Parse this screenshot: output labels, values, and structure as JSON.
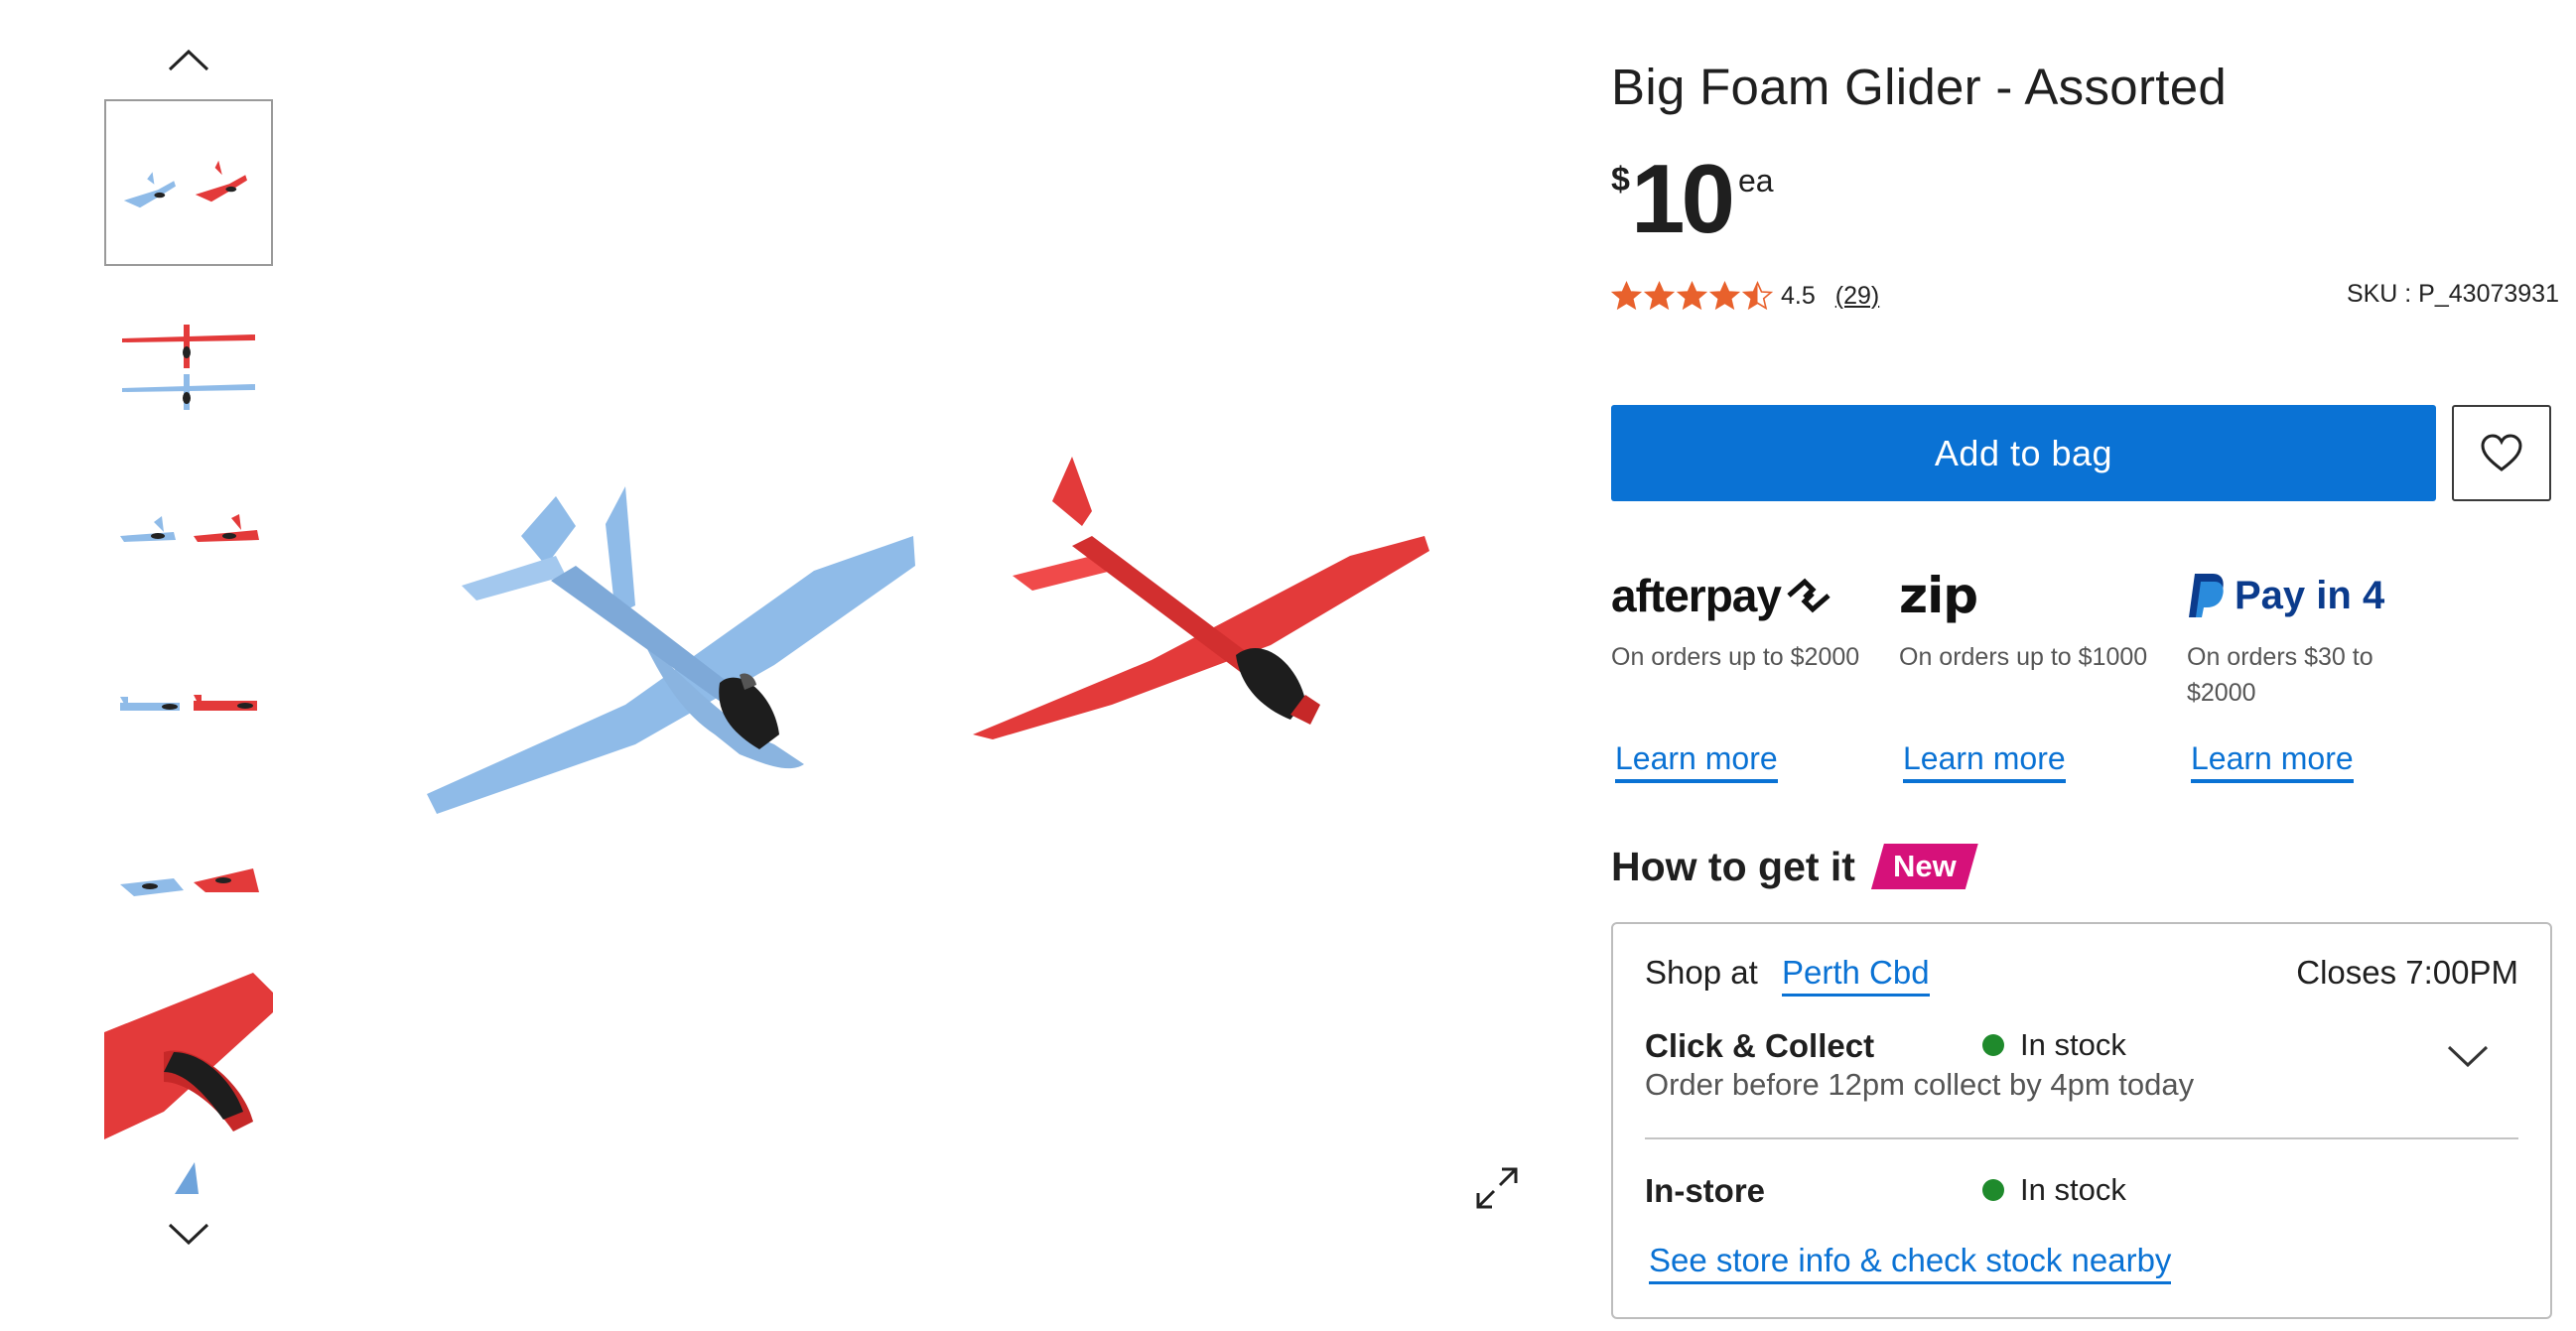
{
  "gallery": {
    "up_icon": "chevron-up-icon",
    "down_icon": "chevron-down-icon",
    "expand_icon": "expand-icon",
    "thumbnail_count": 7,
    "selected_index": 0
  },
  "product": {
    "title": "Big Foam Glider - Assorted",
    "price_currency": "$",
    "price_amount": "10",
    "price_unit": "ea",
    "rating_value": "4.5",
    "rating_stars": 4.5,
    "rating_count": "(29)",
    "sku": "SKU : P_43073931"
  },
  "actions": {
    "add_to_bag": "Add to bag",
    "wishlist_icon": "heart-icon"
  },
  "payments": [
    {
      "name": "afterpay",
      "logo_text": "afterpay",
      "desc": "On orders up to $2000",
      "learn": "Learn more"
    },
    {
      "name": "zip",
      "logo_text": "zip",
      "desc": "On orders up to $1000",
      "learn": "Learn more"
    },
    {
      "name": "paypal",
      "logo_text": "Pay in 4",
      "desc": "On orders $30 to $2000",
      "learn": "Learn more"
    }
  ],
  "fulfilment": {
    "title": "How to get it",
    "badge": "New",
    "shop_at": "Shop at",
    "store": "Perth Cbd",
    "closes": "Closes 7:00PM",
    "click_collect": {
      "title": "Click & Collect",
      "status": "In stock",
      "detail": "Order before 12pm collect by 4pm today"
    },
    "in_store": {
      "title": "In-store",
      "status": "In stock"
    },
    "store_info_link": "See store info & check stock nearby"
  },
  "colors": {
    "primary_blue": "#0a72d4",
    "star_orange": "#e8612c",
    "new_badge": "#d6117a",
    "in_stock_green": "#1f8a2c",
    "glider_blue": "#8fbbe8",
    "glider_red": "#e33a3a"
  }
}
